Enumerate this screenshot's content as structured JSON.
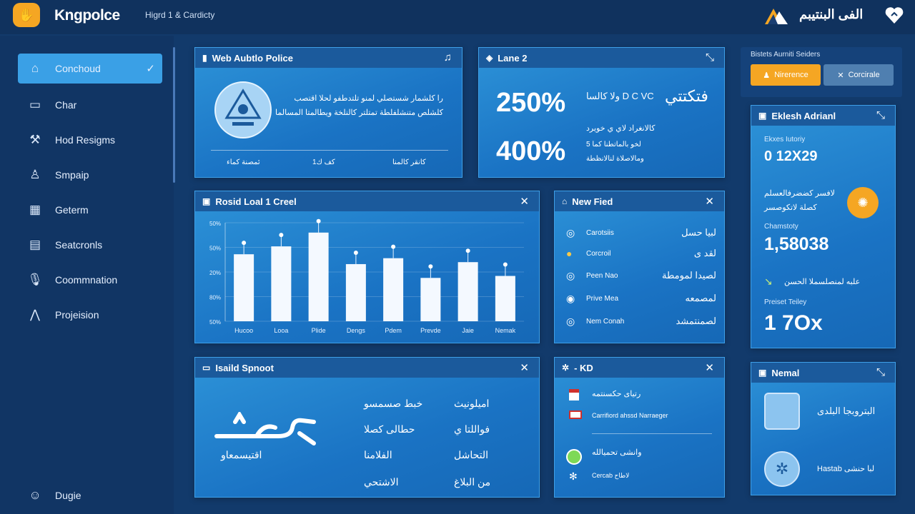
{
  "app": {
    "brand": "Kngpolce",
    "subtitle": "Higrd 1 & Cardicty",
    "top_right_title": "الفى البنتيبم"
  },
  "sidebar": {
    "items": [
      {
        "label": "Conchoud",
        "icon": "tray-icon",
        "active": true
      },
      {
        "label": "Char",
        "icon": "chat-icon"
      },
      {
        "label": "Hod Resigms",
        "icon": "wrench-icon"
      },
      {
        "label": "Smpaip",
        "icon": "person-icon"
      },
      {
        "label": "Geterm",
        "icon": "grid-icon"
      },
      {
        "label": "Seatcronls",
        "icon": "document-icon"
      },
      {
        "label": "Coommnation",
        "icon": "mic-icon"
      },
      {
        "label": "Projeision",
        "icon": "compass-icon"
      }
    ],
    "footer_label": "Dugie"
  },
  "panel1": {
    "title": "Web Aubtlo Police",
    "text_line1": "را كلشمار شستصلي لمنو تلتدطفو لحلا اقتصب",
    "text_line2": "كلشلص متنشلفلطة تمتلتر كالنلخة ويطالمتا المسالما",
    "footer": [
      "ئمصنة كماء",
      "كف ك1",
      "كانقر كالمنا"
    ]
  },
  "panel2": {
    "title": "Lane 2",
    "stat1": "250%",
    "stat2": "400%",
    "label1": "ولا كالسا D C VC",
    "label2": "كالانغراد لاي ي خويرد",
    "label3": "لخو بالماتطنا كما 5",
    "label4": "ومالاصلاة لنالانظطة",
    "script_label": "فتكتتي"
  },
  "account": {
    "label": "Bistets Aurniti Seiders",
    "button1": "Nirerence",
    "button2": "Corcirale"
  },
  "panel3": {
    "title": "Rosid Loal 1 Creel",
    "chart_data": {
      "type": "bar",
      "categories": [
        "Hucoo",
        "Looa",
        "Plide",
        "Dengs",
        "Pdem",
        "Prevde",
        "Jaie",
        "Nemak"
      ],
      "values": [
        68,
        76,
        90,
        58,
        64,
        44,
        60,
        46
      ],
      "ytick_labels": [
        "50%",
        "50%",
        "20%",
        "80%",
        "50%"
      ]
    }
  },
  "panel4": {
    "title": "New Fied",
    "items": [
      {
        "left": "Carotsiis",
        "right": "لبيا حسل",
        "icon": "globe-icon"
      },
      {
        "left": "Corcroil",
        "right": "لقد ى",
        "icon": "coin-icon"
      },
      {
        "left": "Peen Nao",
        "right": "لصيدا لمومطة",
        "icon": "globe-icon"
      },
      {
        "left": "Prive Mea",
        "right": "لمصمعه",
        "icon": "coin-icon"
      },
      {
        "left": "Nem Conah",
        "right": "لصمنتمشد",
        "icon": "globe-icon"
      }
    ]
  },
  "stats": {
    "title": "Eklesh Adrianl",
    "label1": "Ekxes Iutoriy",
    "value1": "0 12X29",
    "text1": "لافسر كضضرفالعسلم",
    "text2": "كصلة لاتكوصسر",
    "label2": "Chamstoty",
    "value2": "1,58038",
    "text3": "علبه لمنصلسملا الحسن",
    "label3": "Preiset Teiley",
    "value3": "1 7Ox"
  },
  "panel5": {
    "title": "Isaild Spnoot",
    "logo_text": "اقتيسمعاو",
    "col1": [
      "خبط صسمسو",
      "حطالى كصلا",
      "الفلامنا",
      "الاشتحي"
    ],
    "col2": [
      "اميلونيث",
      "فواللتا ي",
      "التحاشل",
      "من البلاغ"
    ]
  },
  "panel6": {
    "title": "- KD",
    "row1_a": "رتياى حكسنتمه",
    "row1_b": "Carrifiord ahssd Narraeger",
    "row2_a": "وانشى تحميالله",
    "row2_b": "Cercab لاطاح"
  },
  "panel7": {
    "title": "Nemal",
    "text1": "البتروبجا البلدى",
    "text2": "Hastab لبا حنشى"
  }
}
